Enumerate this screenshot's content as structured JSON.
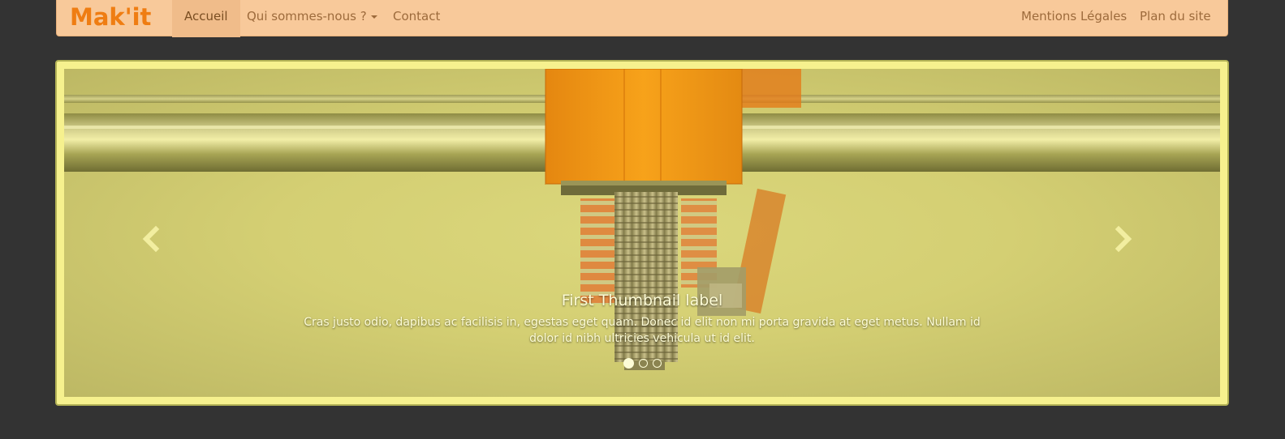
{
  "brand": "Mak'it",
  "nav": {
    "left": [
      {
        "label": "Accueil",
        "active": true
      },
      {
        "label": "Qui sommes-nous ?",
        "dropdown": true
      },
      {
        "label": "Contact"
      }
    ],
    "right": [
      {
        "label": "Mentions Légales"
      },
      {
        "label": "Plan du site"
      }
    ]
  },
  "carousel": {
    "caption_title": "First Thumbnail label",
    "caption_text": "Cras justo odio, dapibus ac facilisis in, egestas eget quam. Donec id elit non mi porta gravida at eget metus. Nullam id dolor id nibh ultricies vehicula ut id elit.",
    "slide_count": 3,
    "active_slide": 1,
    "prev_icon": "chevron-left-icon",
    "next_icon": "chevron-right-icon"
  },
  "colors": {
    "background": "#333333",
    "navbar": "#f8c99a",
    "brand": "#ef7d12",
    "frame": "#f6f18e"
  }
}
